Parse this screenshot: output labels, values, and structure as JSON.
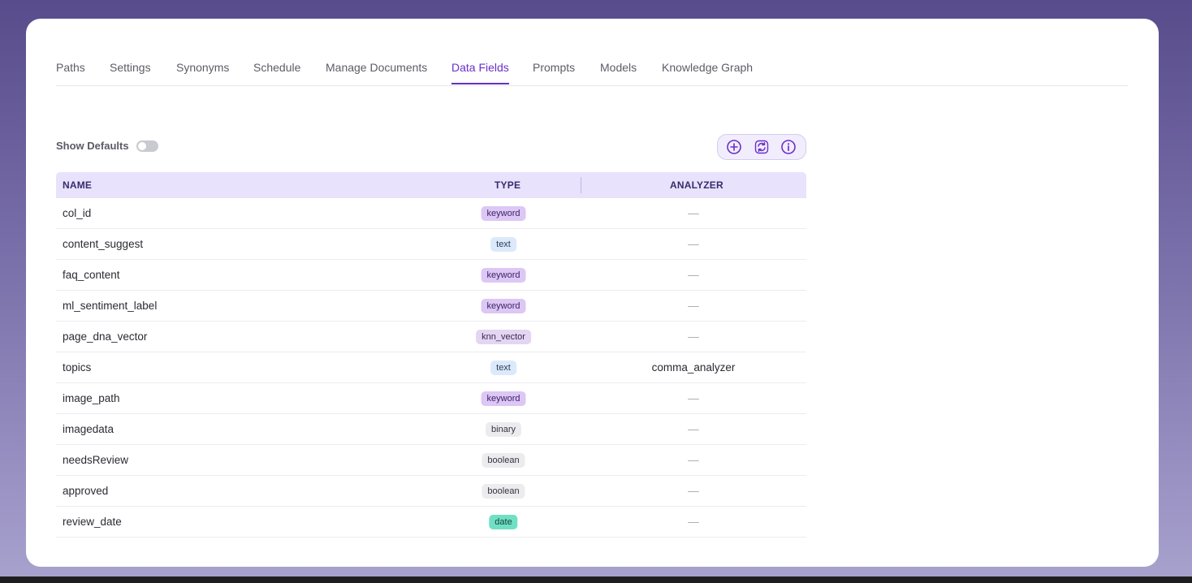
{
  "tabs": [
    {
      "label": "Paths",
      "active": false
    },
    {
      "label": "Settings",
      "active": false
    },
    {
      "label": "Synonyms",
      "active": false
    },
    {
      "label": "Schedule",
      "active": false
    },
    {
      "label": "Manage Documents",
      "active": false
    },
    {
      "label": "Data Fields",
      "active": true
    },
    {
      "label": "Prompts",
      "active": false
    },
    {
      "label": "Models",
      "active": false
    },
    {
      "label": "Knowledge Graph",
      "active": false
    }
  ],
  "controls": {
    "show_defaults_label": "Show Defaults",
    "show_defaults_on": false,
    "actions": [
      {
        "icon": "add-circle-icon"
      },
      {
        "icon": "refresh-icon"
      },
      {
        "icon": "info-icon"
      }
    ]
  },
  "table": {
    "columns": {
      "name": "NAME",
      "type": "TYPE",
      "analyzer": "ANALYZER"
    },
    "rows": [
      {
        "name": "col_id",
        "type": "keyword",
        "analyzer": "—"
      },
      {
        "name": "content_suggest",
        "type": "text",
        "analyzer": "—"
      },
      {
        "name": "faq_content",
        "type": "keyword",
        "analyzer": "—"
      },
      {
        "name": "ml_sentiment_label",
        "type": "keyword",
        "analyzer": "—"
      },
      {
        "name": "page_dna_vector",
        "type": "knn_vector",
        "analyzer": "—"
      },
      {
        "name": "topics",
        "type": "text",
        "analyzer": "comma_analyzer"
      },
      {
        "name": "image_path",
        "type": "keyword",
        "analyzer": "—"
      },
      {
        "name": "imagedata",
        "type": "binary",
        "analyzer": "—"
      },
      {
        "name": "needsReview",
        "type": "boolean",
        "analyzer": "—"
      },
      {
        "name": "approved",
        "type": "boolean",
        "analyzer": "—"
      },
      {
        "name": "review_date",
        "type": "date",
        "analyzer": "—"
      }
    ]
  },
  "type_colors": {
    "keyword": {
      "bg": "#dcc7f5",
      "fg": "#3d2466"
    },
    "text": {
      "bg": "#dbe9fb",
      "fg": "#2d3e5a"
    },
    "knn_vector": {
      "bg": "#e4d5f2",
      "fg": "#3a2a55"
    },
    "binary": {
      "bg": "#ececef",
      "fg": "#333340"
    },
    "boolean": {
      "bg": "#ececef",
      "fg": "#333340"
    },
    "date": {
      "bg": "#6fe0c4",
      "fg": "#13463a"
    }
  },
  "colors": {
    "accent": "#6a2fc8",
    "header_bg": "#e8e2fc"
  }
}
